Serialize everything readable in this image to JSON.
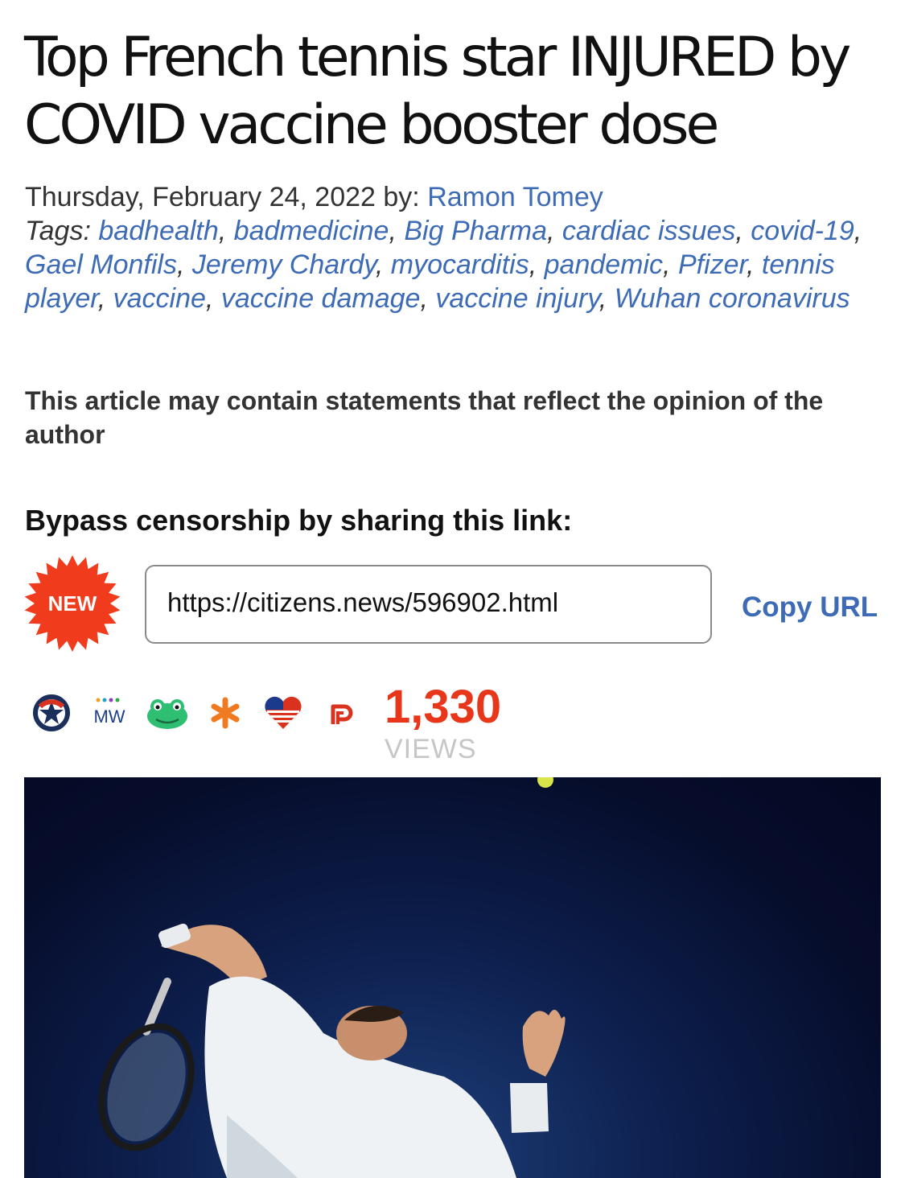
{
  "article": {
    "title": "Top French tennis star INJURED by COVID vaccine booster dose",
    "date_prefix": "Thursday, February 24, 2022 by: ",
    "author": "Ramon Tomey",
    "tags_label": "Tags:",
    "tags": [
      "badhealth",
      "badmedicine",
      "Big Pharma",
      "cardiac issues",
      "covid-19",
      "Gael Monfils",
      "Jeremy Chardy",
      "myocarditis",
      "pandemic",
      "Pfizer",
      "tennis player",
      "vaccine",
      "vaccine damage",
      "vaccine injury",
      "Wuhan coronavirus"
    ],
    "disclaimer": "This article may contain statements that reflect the opinion of the author"
  },
  "share": {
    "heading": "Bypass censorship by sharing this link:",
    "badge_label": "NEW",
    "url": "https://citizens.news/596902.html",
    "copy_label": "Copy URL",
    "icons": [
      "circle-star-icon",
      "mewe-icon",
      "gab-frog-icon",
      "asterisk-icon",
      "usa-heart-icon",
      "parler-icon"
    ]
  },
  "stats": {
    "views_count": "1,330",
    "views_label": "VIEWS"
  },
  "colors": {
    "link": "#3d6bb5",
    "views": "#e8361b",
    "badge": "#f03b1c"
  }
}
